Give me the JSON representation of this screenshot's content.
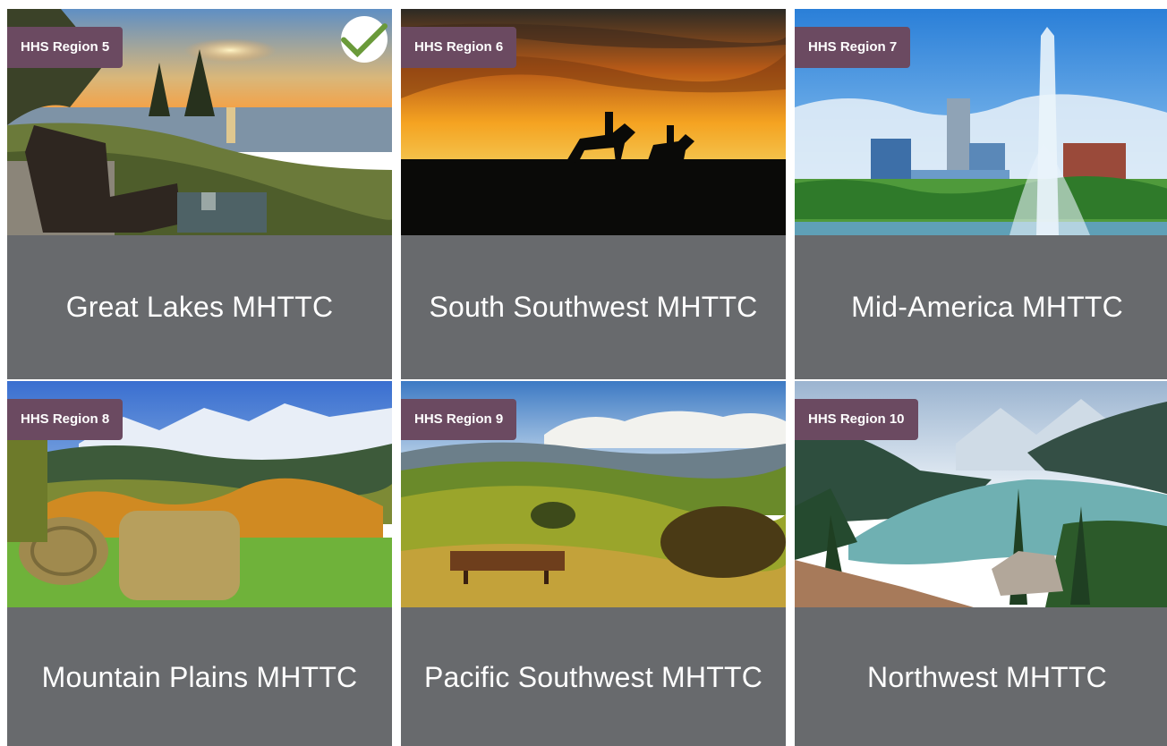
{
  "cards": [
    {
      "badge": "HHS Region 5",
      "title": "Great Lakes MHTTC",
      "selected": true,
      "check_icon": "checkmark-icon",
      "check_color": "#6a9a3a"
    },
    {
      "badge": "HHS Region 6",
      "title": "South Southwest MHTTC",
      "selected": false
    },
    {
      "badge": "HHS Region 7",
      "title": "Mid-America MHTTC",
      "selected": false
    },
    {
      "badge": "HHS Region 8",
      "title": "Mountain Plains MHTTC",
      "selected": false
    },
    {
      "badge": "HHS Region 9",
      "title": "Pacific Southwest MHTTC",
      "selected": false
    },
    {
      "badge": "HHS Region 10",
      "title": "Northwest MHTTC",
      "selected": false
    }
  ],
  "colors": {
    "badge_bg": "#6b4a61",
    "caption_bg": "#686a6d",
    "caption_text": "#ffffff"
  }
}
